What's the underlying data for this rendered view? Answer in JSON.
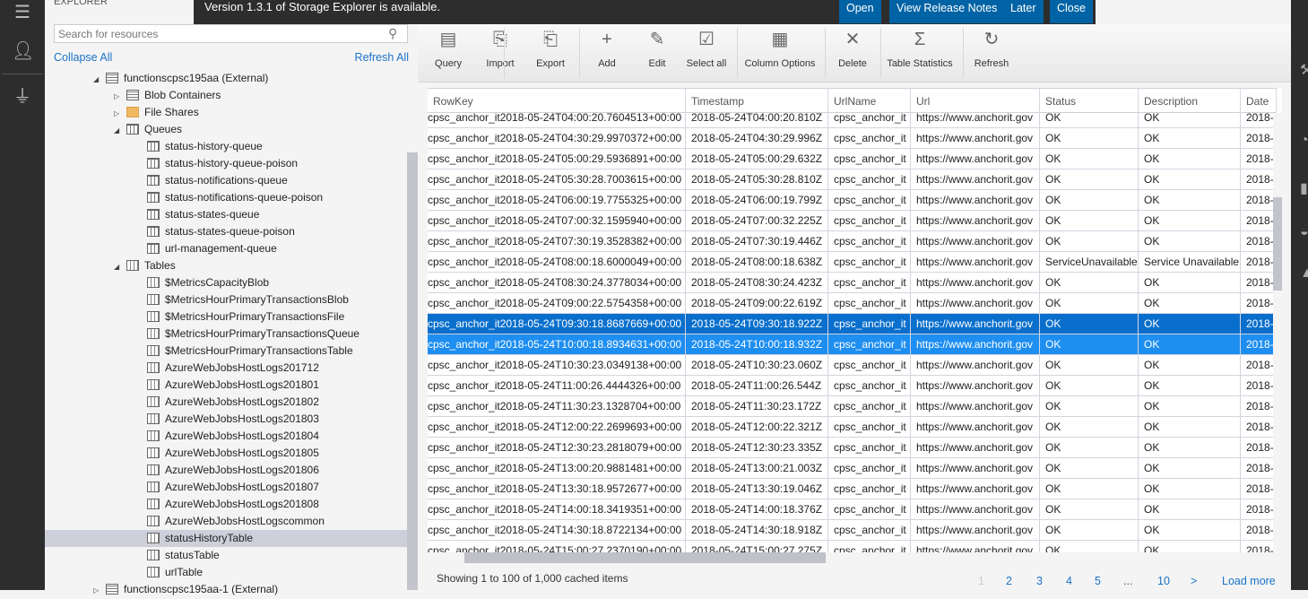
{
  "sidebar": {
    "title": "EXPLORER",
    "search_placeholder": "Search for resources",
    "collapse_all": "Collapse All",
    "refresh_all": "Refresh All",
    "tree": [
      {
        "label": "functionscpsc195aa (External)",
        "level": 0,
        "arrow": "expanded",
        "icon": "storage-account"
      },
      {
        "label": "Blob Containers",
        "level": 1,
        "arrow": "collapsed",
        "icon": "blob"
      },
      {
        "label": "File Shares",
        "level": 1,
        "arrow": "collapsed",
        "icon": "file-share"
      },
      {
        "label": "Queues",
        "level": 1,
        "arrow": "expanded",
        "icon": "queue"
      },
      {
        "label": "status-history-queue",
        "level": 2,
        "icon": "queue"
      },
      {
        "label": "status-history-queue-poison",
        "level": 2,
        "icon": "queue"
      },
      {
        "label": "status-notifications-queue",
        "level": 2,
        "icon": "queue"
      },
      {
        "label": "status-notifications-queue-poison",
        "level": 2,
        "icon": "queue"
      },
      {
        "label": "status-states-queue",
        "level": 2,
        "icon": "queue"
      },
      {
        "label": "status-states-queue-poison",
        "level": 2,
        "icon": "queue"
      },
      {
        "label": "url-management-queue",
        "level": 2,
        "icon": "queue"
      },
      {
        "label": "Tables",
        "level": 1,
        "arrow": "expanded",
        "icon": "table"
      },
      {
        "label": "$MetricsCapacityBlob",
        "level": 2,
        "icon": "table"
      },
      {
        "label": "$MetricsHourPrimaryTransactionsBlob",
        "level": 2,
        "icon": "table"
      },
      {
        "label": "$MetricsHourPrimaryTransactionsFile",
        "level": 2,
        "icon": "table"
      },
      {
        "label": "$MetricsHourPrimaryTransactionsQueue",
        "level": 2,
        "icon": "table"
      },
      {
        "label": "$MetricsHourPrimaryTransactionsTable",
        "level": 2,
        "icon": "table"
      },
      {
        "label": "AzureWebJobsHostLogs201712",
        "level": 2,
        "icon": "table"
      },
      {
        "label": "AzureWebJobsHostLogs201801",
        "level": 2,
        "icon": "table"
      },
      {
        "label": "AzureWebJobsHostLogs201802",
        "level": 2,
        "icon": "table"
      },
      {
        "label": "AzureWebJobsHostLogs201803",
        "level": 2,
        "icon": "table"
      },
      {
        "label": "AzureWebJobsHostLogs201804",
        "level": 2,
        "icon": "table"
      },
      {
        "label": "AzureWebJobsHostLogs201805",
        "level": 2,
        "icon": "table"
      },
      {
        "label": "AzureWebJobsHostLogs201806",
        "level": 2,
        "icon": "table"
      },
      {
        "label": "AzureWebJobsHostLogs201807",
        "level": 2,
        "icon": "table"
      },
      {
        "label": "AzureWebJobsHostLogs201808",
        "level": 2,
        "icon": "table"
      },
      {
        "label": "AzureWebJobsHostLogscommon",
        "level": 2,
        "icon": "table"
      },
      {
        "label": "statusHistoryTable",
        "level": 2,
        "icon": "table",
        "selected": true
      },
      {
        "label": "statusTable",
        "level": 2,
        "icon": "table"
      },
      {
        "label": "urlTable",
        "level": 2,
        "icon": "table"
      },
      {
        "label": "functionscpsc195aa-1 (External)",
        "level": 0,
        "arrow": "collapsed",
        "icon": "storage-account"
      }
    ]
  },
  "banner": {
    "message": "Version 1.3.1 of Storage Explorer is available.",
    "buttons": [
      "Open",
      "View Release Notes",
      "Later",
      "Close"
    ],
    "color": "#0063a5"
  },
  "toolbar": [
    {
      "label": "Query",
      "icon": "query-icon",
      "glyph": "▤"
    },
    {
      "label": "Import",
      "icon": "import-icon",
      "glyph": "⎘"
    },
    {
      "label": "Export",
      "icon": "export-icon",
      "glyph": "⎗"
    },
    {
      "label": "Add",
      "icon": "add-icon",
      "glyph": "+"
    },
    {
      "label": "Edit",
      "icon": "edit-icon",
      "glyph": "✎"
    },
    {
      "label": "Select all",
      "icon": "select-all-icon",
      "glyph": "☑"
    },
    {
      "label": "Column Options",
      "icon": "column-options-icon",
      "glyph": "▦"
    },
    {
      "label": "Delete",
      "icon": "delete-icon",
      "glyph": "✕"
    },
    {
      "label": "Table Statistics",
      "icon": "sigma-icon",
      "glyph": "Σ"
    },
    {
      "label": "Refresh",
      "icon": "refresh-icon",
      "glyph": "↻"
    }
  ],
  "table": {
    "columns": [
      "RowKey",
      "Timestamp",
      "UrlName",
      "Url",
      "Status",
      "Description",
      "Date"
    ],
    "rows": [
      [
        "cpsc_anchor_it2018-05-24T04:00:20.7604513+00:00",
        "2018-05-24T04:00:20.810Z",
        "cpsc_anchor_it",
        "https://www.anchorit.gov",
        "OK",
        "OK",
        "2018-"
      ],
      [
        "cpsc_anchor_it2018-05-24T04:30:29.9970372+00:00",
        "2018-05-24T04:30:29.996Z",
        "cpsc_anchor_it",
        "https://www.anchorit.gov",
        "OK",
        "OK",
        "2018-"
      ],
      [
        "cpsc_anchor_it2018-05-24T05:00:29.5936891+00:00",
        "2018-05-24T05:00:29.632Z",
        "cpsc_anchor_it",
        "https://www.anchorit.gov",
        "OK",
        "OK",
        "2018-"
      ],
      [
        "cpsc_anchor_it2018-05-24T05:30:28.7003615+00:00",
        "2018-05-24T05:30:28.810Z",
        "cpsc_anchor_it",
        "https://www.anchorit.gov",
        "OK",
        "OK",
        "2018-"
      ],
      [
        "cpsc_anchor_it2018-05-24T06:00:19.7755325+00:00",
        "2018-05-24T06:00:19.799Z",
        "cpsc_anchor_it",
        "https://www.anchorit.gov",
        "OK",
        "OK",
        "2018-"
      ],
      [
        "cpsc_anchor_it2018-05-24T07:00:32.1595940+00:00",
        "2018-05-24T07:00:32.225Z",
        "cpsc_anchor_it",
        "https://www.anchorit.gov",
        "OK",
        "OK",
        "2018-"
      ],
      [
        "cpsc_anchor_it2018-05-24T07:30:19.3528382+00:00",
        "2018-05-24T07:30:19.446Z",
        "cpsc_anchor_it",
        "https://www.anchorit.gov",
        "OK",
        "OK",
        "2018-"
      ],
      [
        "cpsc_anchor_it2018-05-24T08:00:18.6000049+00:00",
        "2018-05-24T08:00:18.638Z",
        "cpsc_anchor_it",
        "https://www.anchorit.gov",
        "ServiceUnavailable",
        "Service Unavailable",
        "2018-"
      ],
      [
        "cpsc_anchor_it2018-05-24T08:30:24.3778034+00:00",
        "2018-05-24T08:30:24.423Z",
        "cpsc_anchor_it",
        "https://www.anchorit.gov",
        "OK",
        "OK",
        "2018-"
      ],
      [
        "cpsc_anchor_it2018-05-24T09:00:22.5754358+00:00",
        "2018-05-24T09:00:22.619Z",
        "cpsc_anchor_it",
        "https://www.anchorit.gov",
        "OK",
        "OK",
        "2018-"
      ],
      [
        "cpsc_anchor_it2018-05-24T09:30:18.8687669+00:00",
        "2018-05-24T09:30:18.922Z",
        "cpsc_anchor_it",
        "https://www.anchorit.gov",
        "OK",
        "OK",
        "2018-"
      ],
      [
        "cpsc_anchor_it2018-05-24T10:00:18.8934631+00:00",
        "2018-05-24T10:00:18.932Z",
        "cpsc_anchor_it",
        "https://www.anchorit.gov",
        "OK",
        "OK",
        "2018-"
      ],
      [
        "cpsc_anchor_it2018-05-24T10:30:23.0349138+00:00",
        "2018-05-24T10:30:23.060Z",
        "cpsc_anchor_it",
        "https://www.anchorit.gov",
        "OK",
        "OK",
        "2018-"
      ],
      [
        "cpsc_anchor_it2018-05-24T11:00:26.4444326+00:00",
        "2018-05-24T11:00:26.544Z",
        "cpsc_anchor_it",
        "https://www.anchorit.gov",
        "OK",
        "OK",
        "2018-"
      ],
      [
        "cpsc_anchor_it2018-05-24T11:30:23.1328704+00:00",
        "2018-05-24T11:30:23.172Z",
        "cpsc_anchor_it",
        "https://www.anchorit.gov",
        "OK",
        "OK",
        "2018-"
      ],
      [
        "cpsc_anchor_it2018-05-24T12:00:22.2699693+00:00",
        "2018-05-24T12:00:22.321Z",
        "cpsc_anchor_it",
        "https://www.anchorit.gov",
        "OK",
        "OK",
        "2018-"
      ],
      [
        "cpsc_anchor_it2018-05-24T12:30:23.2818079+00:00",
        "2018-05-24T12:30:23.335Z",
        "cpsc_anchor_it",
        "https://www.anchorit.gov",
        "OK",
        "OK",
        "2018-"
      ],
      [
        "cpsc_anchor_it2018-05-24T13:00:20.9881481+00:00",
        "2018-05-24T13:00:21.003Z",
        "cpsc_anchor_it",
        "https://www.anchorit.gov",
        "OK",
        "OK",
        "2018-"
      ],
      [
        "cpsc_anchor_it2018-05-24T13:30:18.9572677+00:00",
        "2018-05-24T13:30:19.046Z",
        "cpsc_anchor_it",
        "https://www.anchorit.gov",
        "OK",
        "OK",
        "2018-"
      ],
      [
        "cpsc_anchor_it2018-05-24T14:00:18.3419351+00:00",
        "2018-05-24T14:00:18.376Z",
        "cpsc_anchor_it",
        "https://www.anchorit.gov",
        "OK",
        "OK",
        "2018-"
      ],
      [
        "cpsc_anchor_it2018-05-24T14:30:18.8722134+00:00",
        "2018-05-24T14:30:18.918Z",
        "cpsc_anchor_it",
        "https://www.anchorit.gov",
        "OK",
        "OK",
        "2018-"
      ],
      [
        "cpsc_anchor_it2018-05-24T15:00:27.2370190+00:00",
        "2018-05-24T15:00:27.275Z",
        "cpsc_anchor_it",
        "https://www.anchorit.gov",
        "OK",
        "OK",
        "2018-"
      ]
    ],
    "selected_rows": [
      10,
      11
    ],
    "selection_colors": [
      "#0a6fcc",
      "#1e8ef0"
    ]
  },
  "footer": {
    "showing": "Showing 1 to 100 of 1,000 cached items",
    "pages": [
      "1",
      "2",
      "3",
      "4",
      "5",
      "...",
      "10",
      ">"
    ],
    "current_page": "1",
    "load_more": "Load more"
  }
}
